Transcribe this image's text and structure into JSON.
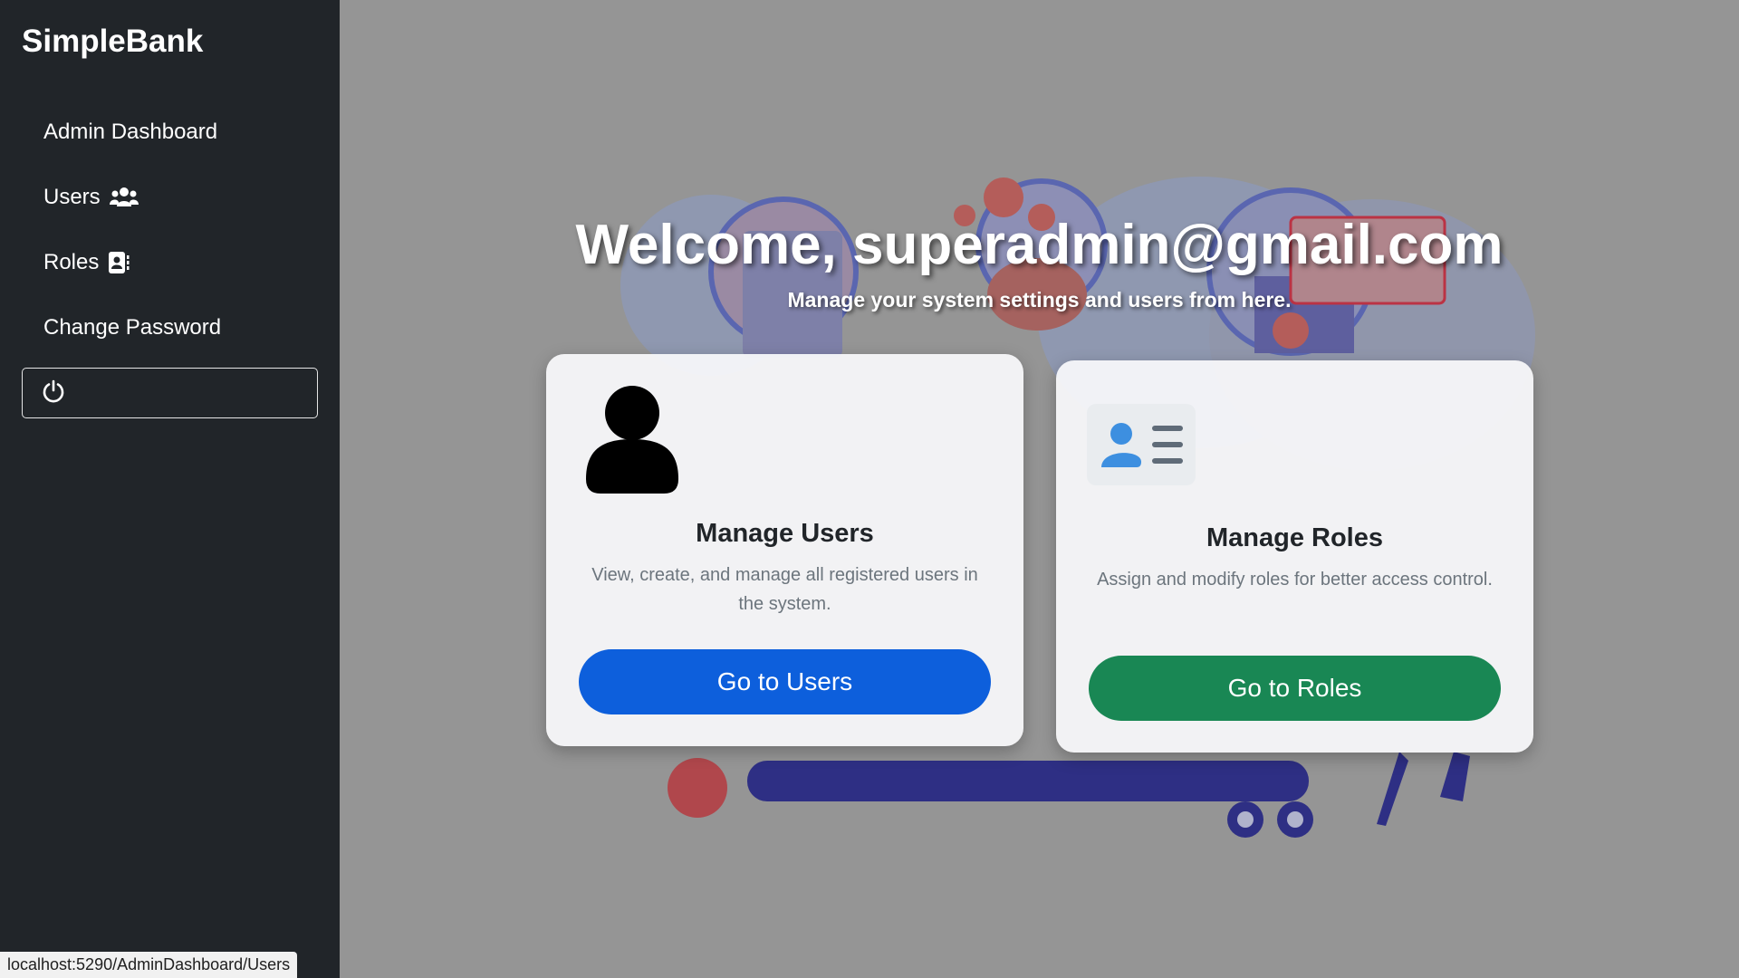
{
  "sidebar": {
    "brand": "SimpleBank",
    "items": [
      {
        "label": "Admin Dashboard",
        "icon": ""
      },
      {
        "label": "Users",
        "icon": "users-icon"
      },
      {
        "label": "Roles",
        "icon": "id-card-icon"
      },
      {
        "label": "Change Password",
        "icon": ""
      }
    ],
    "logout_icon": "power-icon"
  },
  "status_bar": {
    "url": "localhost:5290/AdminDashboard/Users"
  },
  "main": {
    "welcome": "Welcome, superadmin@gmail.com",
    "subtitle": "Manage your system settings and users from here.",
    "cards": [
      {
        "icon": "user-icon",
        "title": "Manage Users",
        "text": "View, create, and manage all registered users in the system.",
        "button": "Go to Users",
        "button_color": "#0d5fdc"
      },
      {
        "icon": "roles-icon",
        "title": "Manage Roles",
        "text": "Assign and modify roles for better access control.",
        "button": "Go to Roles",
        "button_color": "#198754"
      }
    ]
  },
  "colors": {
    "sidebar_bg": "#212529",
    "main_bg": "#959595",
    "primary": "#0d5fdc",
    "success": "#198754"
  }
}
